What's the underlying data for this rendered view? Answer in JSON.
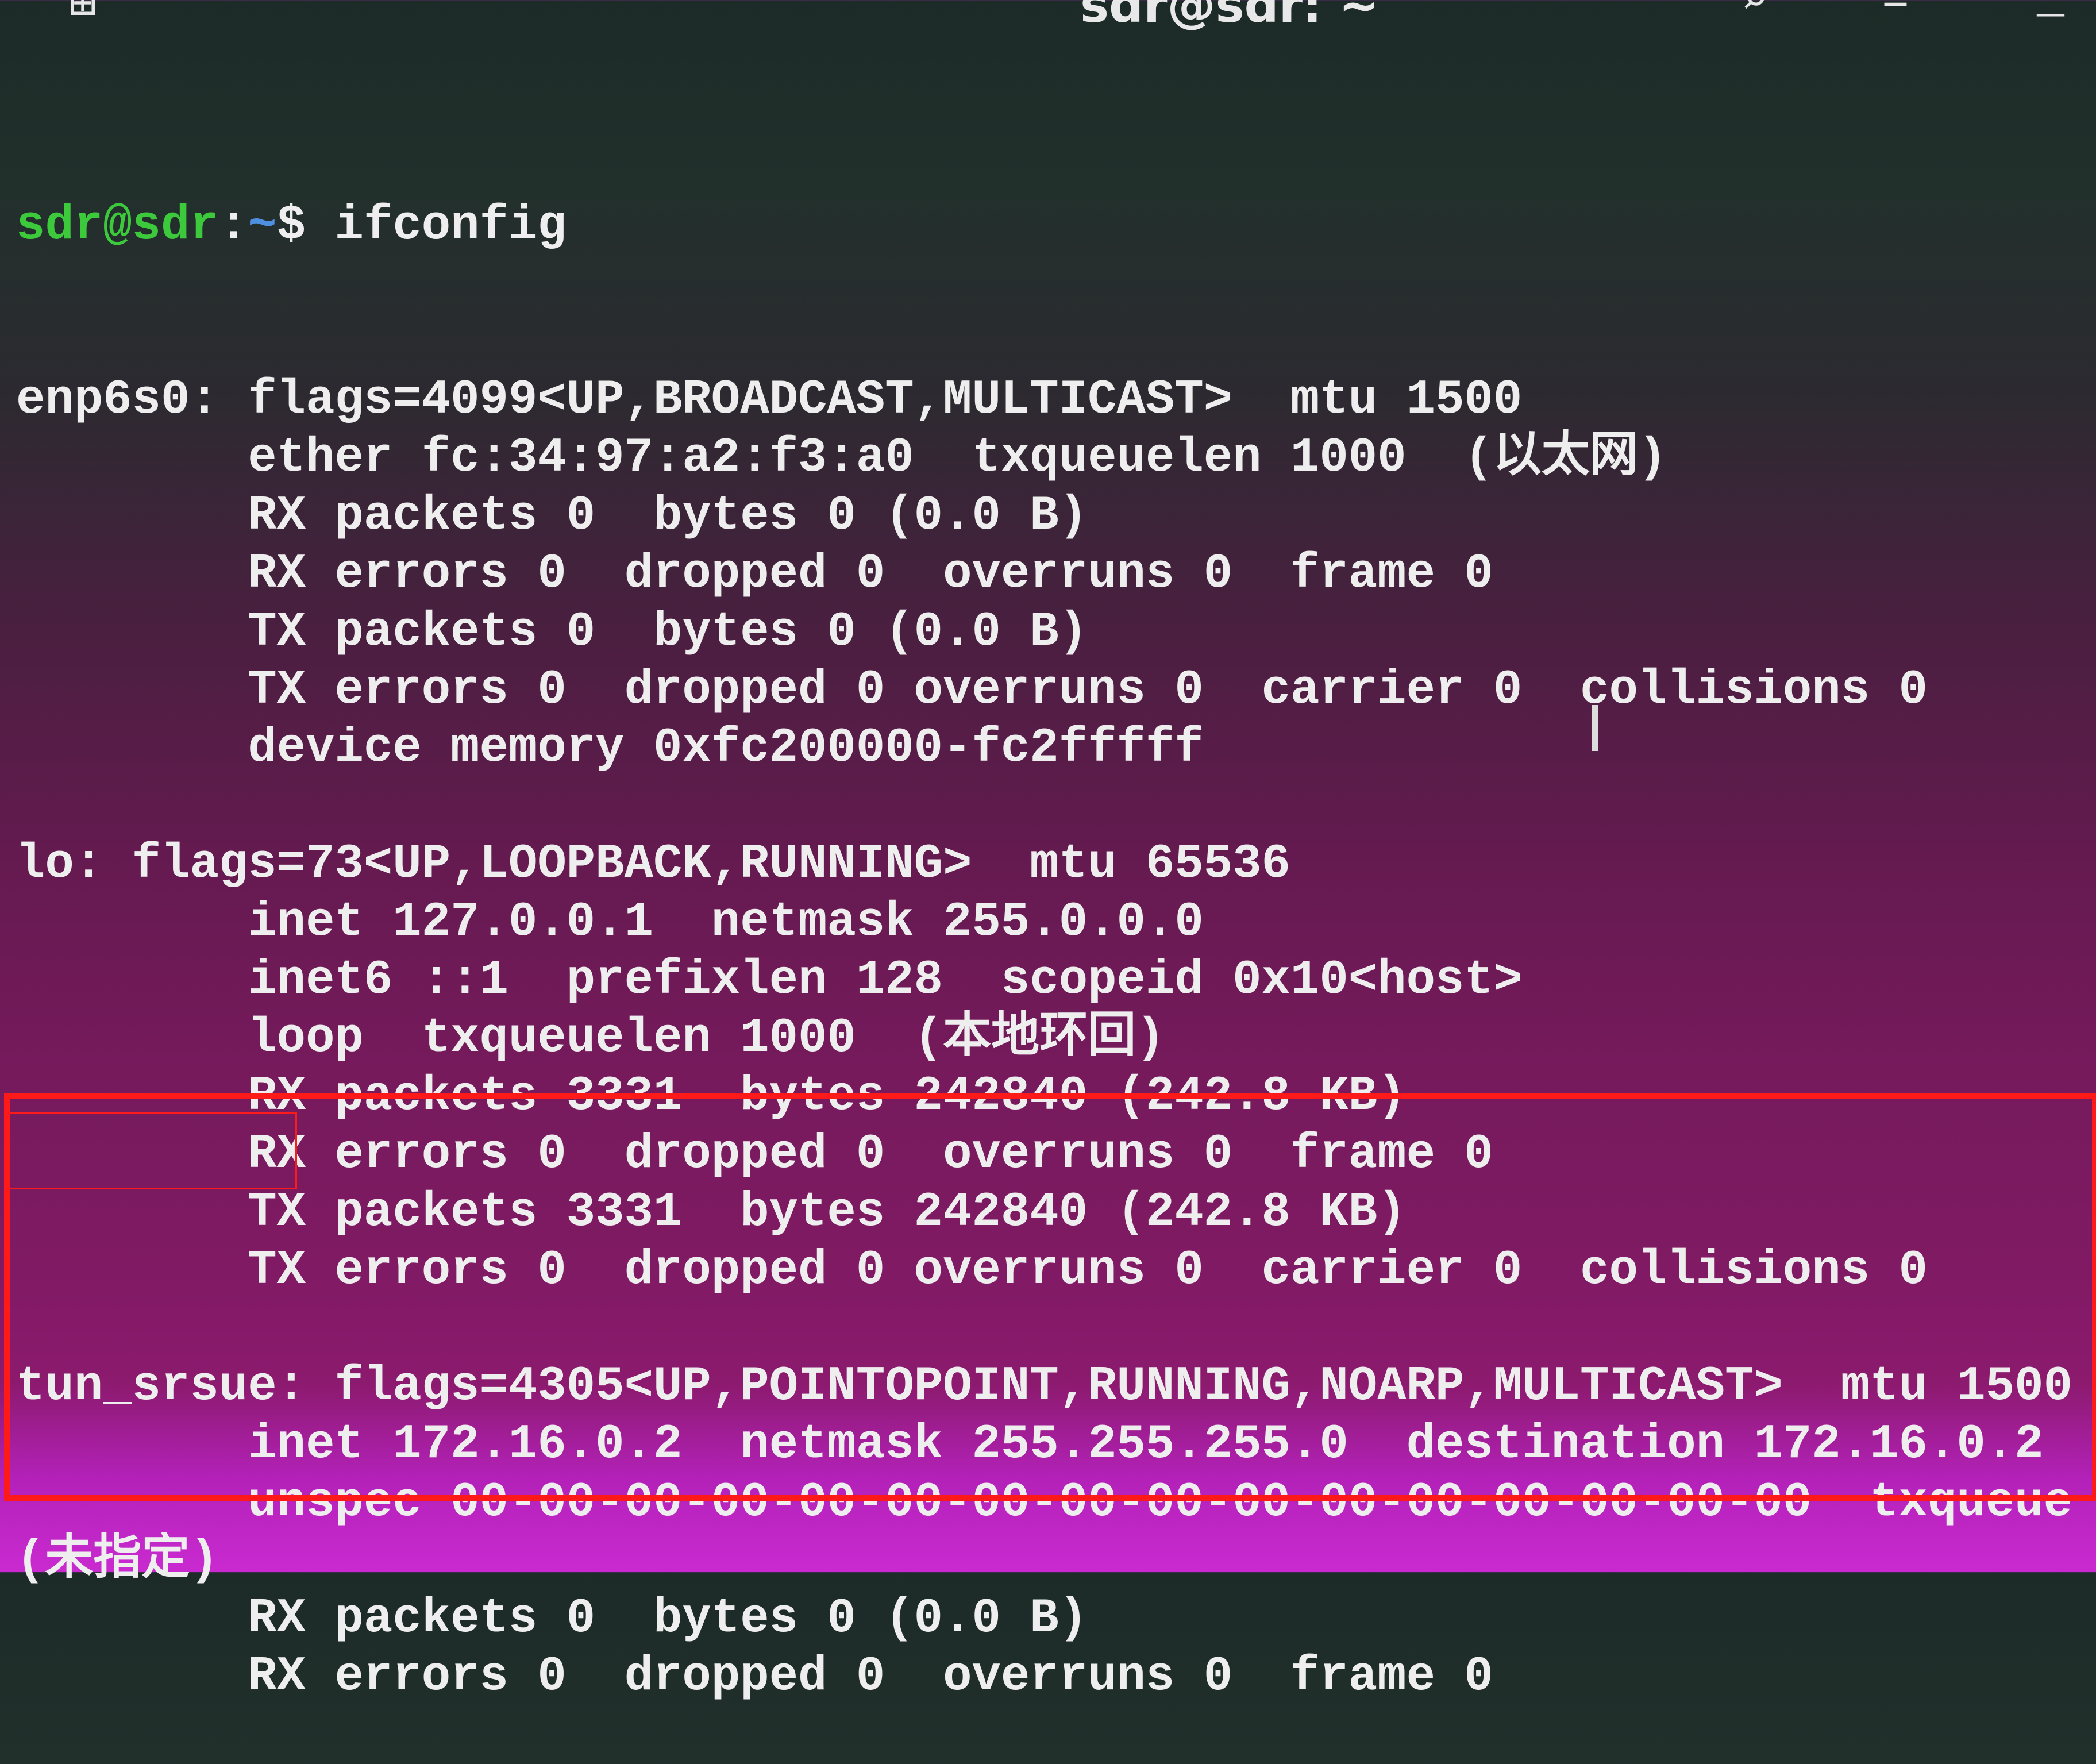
{
  "window": {
    "title": "sdr@sdr: ~",
    "icons": [
      "new-tab-icon",
      "search-icon",
      "menu-icon",
      "minimize-icon"
    ]
  },
  "prompt": {
    "user_host": "sdr@sdr",
    "sep": ":",
    "path": "~",
    "dollar": "$ ",
    "command": "ifconfig"
  },
  "colors": {
    "prompt_green": "#3cc93c",
    "path_blue": "#4f8fe0",
    "highlight_red": "#ff1a1a"
  },
  "output_lines": [
    "enp6s0: flags=4099<UP,BROADCAST,MULTICAST>  mtu 1500",
    "        ether fc:34:97:a2:f3:a0  txqueuelen 1000  (以太网)",
    "        RX packets 0  bytes 0 (0.0 B)",
    "        RX errors 0  dropped 0  overruns 0  frame 0",
    "        TX packets 0  bytes 0 (0.0 B)",
    "        TX errors 0  dropped 0 overruns 0  carrier 0  collisions 0",
    "        device memory 0xfc200000-fc2fffff",
    "",
    "lo: flags=73<UP,LOOPBACK,RUNNING>  mtu 65536",
    "        inet 127.0.0.1  netmask 255.0.0.0",
    "        inet6 ::1  prefixlen 128  scopeid 0x10<host>",
    "        loop  txqueuelen 1000  (本地环回)",
    "        RX packets 3331  bytes 242840 (242.8 KB)",
    "        RX errors 0  dropped 0  overruns 0  frame 0",
    "        TX packets 3331  bytes 242840 (242.8 KB)",
    "        TX errors 0  dropped 0 overruns 0  carrier 0  collisions 0",
    "",
    "tun_srsue: flags=4305<UP,POINTOPOINT,RUNNING,NOARP,MULTICAST>  mtu 1500",
    "        inet 172.16.0.2  netmask 255.255.255.0  destination 172.16.0.2",
    "        unspec 00-00-00-00-00-00-00-00-00-00-00-00-00-00-00-00  txqueue",
    "(未指定)",
    "        RX packets 0  bytes 0 (0.0 B)",
    "        RX errors 0  dropped 0  overruns 0  frame 0"
  ]
}
